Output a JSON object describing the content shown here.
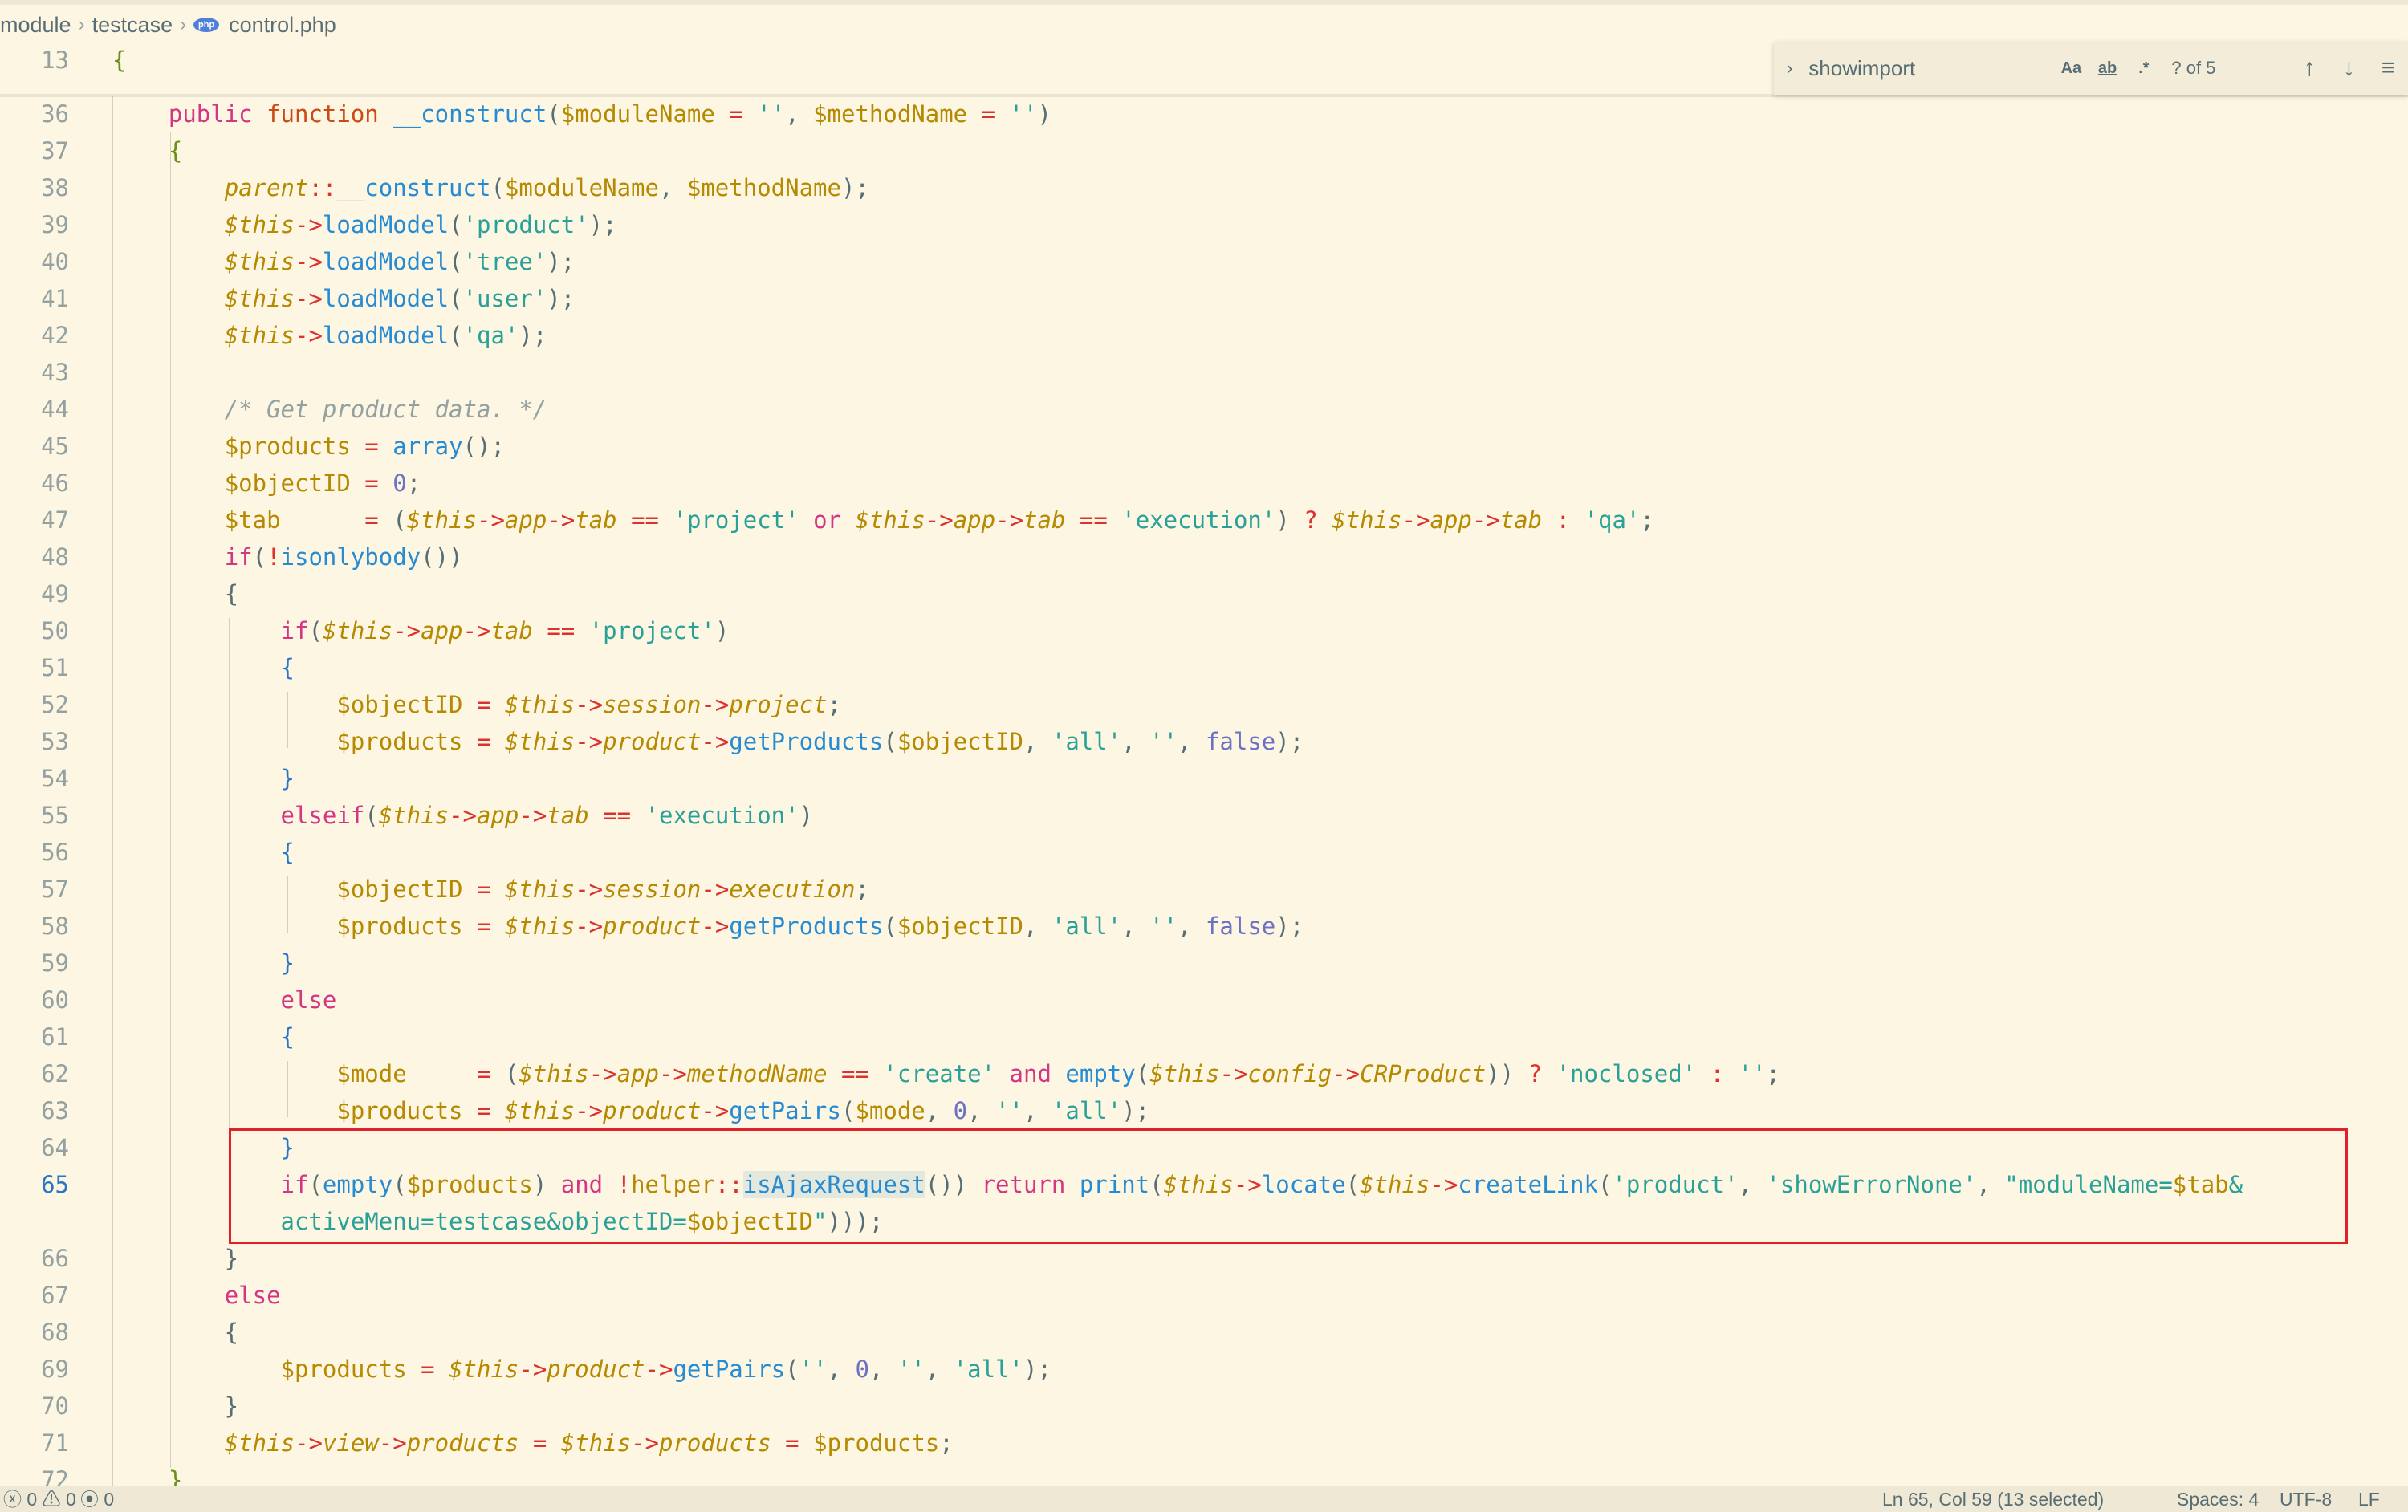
{
  "breadcrumb": {
    "items": [
      "module",
      "testcase",
      "control.php"
    ],
    "file_icon_text": "php"
  },
  "find_widget": {
    "query": "showimport",
    "match_case_label": "Aa",
    "whole_word_label": "ab",
    "regex_label": ".*",
    "match_count": "? of 5"
  },
  "editor": {
    "lines": [
      {
        "n": "13",
        "html": "<span class=\"brace\">{</span>"
      },
      {
        "n": "36",
        "html": "    <span class=\"k-pink\">public</span> <span class=\"k-orange\">function</span> <span class=\"fn\">__construct</span>(<span class=\"var\">$moduleName</span> <span class=\"op\">=</span> <span class=\"str\">''</span>, <span class=\"var\">$methodName</span> <span class=\"op\">=</span> <span class=\"str\">''</span>)"
      },
      {
        "n": "37",
        "html": "    <span class=\"brace\">{</span>"
      },
      {
        "n": "38",
        "html": "        <span class=\"var ital\">parent</span><span class=\"op\">::</span><span class=\"fn\">__construct</span>(<span class=\"var\">$moduleName</span>, <span class=\"var\">$methodName</span>);"
      },
      {
        "n": "39",
        "html": "        <span class=\"var ital\">$this</span><span class=\"op\">-&gt;</span><span class=\"fn\">loadModel</span>(<span class=\"str\">'product'</span>);"
      },
      {
        "n": "40",
        "html": "        <span class=\"var ital\">$this</span><span class=\"op\">-&gt;</span><span class=\"fn\">loadModel</span>(<span class=\"str\">'tree'</span>);"
      },
      {
        "n": "41",
        "html": "        <span class=\"var ital\">$this</span><span class=\"op\">-&gt;</span><span class=\"fn\">loadModel</span>(<span class=\"str\">'user'</span>);"
      },
      {
        "n": "42",
        "html": "        <span class=\"var ital\">$this</span><span class=\"op\">-&gt;</span><span class=\"fn\">loadModel</span>(<span class=\"str\">'qa'</span>);"
      },
      {
        "n": "43",
        "html": ""
      },
      {
        "n": "44",
        "html": "        <span class=\"cm\">/* Get product data. */</span>"
      },
      {
        "n": "45",
        "html": "        <span class=\"var\">$products</span> <span class=\"op\">=</span> <span class=\"fn\">array</span>();"
      },
      {
        "n": "46",
        "html": "        <span class=\"var\">$objectID</span> <span class=\"op\">=</span> <span class=\"num\">0</span>;"
      },
      {
        "n": "47",
        "html": "        <span class=\"var\">$tab</span>      <span class=\"op\">=</span> (<span class=\"var ital\">$this</span><span class=\"op\">-&gt;</span><span class=\"var ital\">app</span><span class=\"op\">-&gt;</span><span class=\"var ital\">tab</span> <span class=\"op\">==</span> <span class=\"str\">'project'</span> <span class=\"k-pink\">or</span> <span class=\"var ital\">$this</span><span class=\"op\">-&gt;</span><span class=\"var ital\">app</span><span class=\"op\">-&gt;</span><span class=\"var ital\">tab</span> <span class=\"op\">==</span> <span class=\"str\">'execution'</span>) <span class=\"op\">?</span> <span class=\"var ital\">$this</span><span class=\"op\">-&gt;</span><span class=\"var ital\">app</span><span class=\"op\">-&gt;</span><span class=\"var ital\">tab</span> <span class=\"op\">:</span> <span class=\"str\">'qa'</span>;"
      },
      {
        "n": "48",
        "html": "        <span class=\"k-pink\">if</span>(<span class=\"op\">!</span><span class=\"fn\">isonlybody</span>())"
      },
      {
        "n": "49",
        "html": "        {"
      },
      {
        "n": "50",
        "html": "            <span class=\"k-pink\">if</span>(<span class=\"var ital\">$this</span><span class=\"op\">-&gt;</span><span class=\"var ital\">app</span><span class=\"op\">-&gt;</span><span class=\"var ital\">tab</span> <span class=\"op\">==</span> <span class=\"str\">'project'</span>)"
      },
      {
        "n": "51",
        "html": "            <span class=\"brace2\">{</span>"
      },
      {
        "n": "52",
        "html": "                <span class=\"var\">$objectID</span> <span class=\"op\">=</span> <span class=\"var ital\">$this</span><span class=\"op\">-&gt;</span><span class=\"var ital\">session</span><span class=\"op\">-&gt;</span><span class=\"var ital\">project</span>;"
      },
      {
        "n": "53",
        "html": "                <span class=\"var\">$products</span> <span class=\"op\">=</span> <span class=\"var ital\">$this</span><span class=\"op\">-&gt;</span><span class=\"var ital\">product</span><span class=\"op\">-&gt;</span><span class=\"fn\">getProducts</span>(<span class=\"var\">$objectID</span>, <span class=\"str\">'all'</span>, <span class=\"str\">''</span>, <span class=\"num\">false</span>);"
      },
      {
        "n": "54",
        "html": "            <span class=\"brace2\">}</span>"
      },
      {
        "n": "55",
        "html": "            <span class=\"k-pink\">elseif</span>(<span class=\"var ital\">$this</span><span class=\"op\">-&gt;</span><span class=\"var ital\">app</span><span class=\"op\">-&gt;</span><span class=\"var ital\">tab</span> <span class=\"op\">==</span> <span class=\"str\">'execution'</span>)"
      },
      {
        "n": "56",
        "html": "            <span class=\"brace2\">{</span>"
      },
      {
        "n": "57",
        "html": "                <span class=\"var\">$objectID</span> <span class=\"op\">=</span> <span class=\"var ital\">$this</span><span class=\"op\">-&gt;</span><span class=\"var ital\">session</span><span class=\"op\">-&gt;</span><span class=\"var ital\">execution</span>;"
      },
      {
        "n": "58",
        "html": "                <span class=\"var\">$products</span> <span class=\"op\">=</span> <span class=\"var ital\">$this</span><span class=\"op\">-&gt;</span><span class=\"var ital\">product</span><span class=\"op\">-&gt;</span><span class=\"fn\">getProducts</span>(<span class=\"var\">$objectID</span>, <span class=\"str\">'all'</span>, <span class=\"str\">''</span>, <span class=\"num\">false</span>);"
      },
      {
        "n": "59",
        "html": "            <span class=\"brace2\">}</span>"
      },
      {
        "n": "60",
        "html": "            <span class=\"k-pink\">else</span>"
      },
      {
        "n": "61",
        "html": "            <span class=\"brace2\">{</span>"
      },
      {
        "n": "62",
        "html": "                <span class=\"var\">$mode</span>     <span class=\"op\">=</span> (<span class=\"var ital\">$this</span><span class=\"op\">-&gt;</span><span class=\"var ital\">app</span><span class=\"op\">-&gt;</span><span class=\"var ital\">methodName</span> <span class=\"op\">==</span> <span class=\"str\">'create'</span> <span class=\"k-pink\">and</span> <span class=\"fn\">empty</span>(<span class=\"var ital\">$this</span><span class=\"op\">-&gt;</span><span class=\"var ital\">config</span><span class=\"op\">-&gt;</span><span class=\"var ital\">CRProduct</span>)) <span class=\"op\">?</span> <span class=\"str\">'noclosed'</span> <span class=\"op\">:</span> <span class=\"str\">''</span>;"
      },
      {
        "n": "63",
        "html": "                <span class=\"var\">$products</span> <span class=\"op\">=</span> <span class=\"var ital\">$this</span><span class=\"op\">-&gt;</span><span class=\"var ital\">product</span><span class=\"op\">-&gt;</span><span class=\"fn\">getPairs</span>(<span class=\"var\">$mode</span>, <span class=\"num\">0</span>, <span class=\"str\">''</span>, <span class=\"str\">'all'</span>);"
      },
      {
        "n": "64",
        "html": "            <span class=\"brace2\">}</span>"
      },
      {
        "n": "65",
        "html": "            <span class=\"k-pink\">if</span>(<span class=\"fn\">empty</span>(<span class=\"var\">$products</span>) <span class=\"k-pink\">and</span> <span class=\"op\">!</span><span class=\"var\">helper</span><span class=\"op\">::</span><span class=\"fn hl\">isAjaxRequest</span>()) <span class=\"k-pink\">return</span> <span class=\"fn\">print</span>(<span class=\"var ital\">$this</span><span class=\"op\">-&gt;</span><span class=\"fn\">locate</span>(<span class=\"var ital\">$this</span><span class=\"op\">-&gt;</span><span class=\"fn\">createLink</span>(<span class=\"str\">'product'</span>, <span class=\"str\">'showErrorNone'</span>, <span class=\"str\">\"moduleName=</span><span class=\"var\">$tab</span><span class=\"str\">&amp;</span>"
      },
      {
        "n": "",
        "html": "            <span class=\"str\">activeMenu=testcase&amp;objectID=</span><span class=\"var\">$objectID</span><span class=\"str\">\"</span>)));"
      },
      {
        "n": "66",
        "html": "        }"
      },
      {
        "n": "67",
        "html": "        <span class=\"k-pink\">else</span>"
      },
      {
        "n": "68",
        "html": "        {"
      },
      {
        "n": "69",
        "html": "            <span class=\"var\">$products</span> <span class=\"op\">=</span> <span class=\"var ital\">$this</span><span class=\"op\">-&gt;</span><span class=\"var ital\">product</span><span class=\"op\">-&gt;</span><span class=\"fn\">getPairs</span>(<span class=\"str\">''</span>, <span class=\"num\">0</span>, <span class=\"str\">''</span>, <span class=\"str\">'all'</span>);"
      },
      {
        "n": "70",
        "html": "        }"
      },
      {
        "n": "71",
        "html": "        <span class=\"var ital\">$this</span><span class=\"op\">-&gt;</span><span class=\"var ital\">view</span><span class=\"op\">-&gt;</span><span class=\"var ital\">products</span> <span class=\"op\">=</span> <span class=\"var ital\">$this</span><span class=\"op\">-&gt;</span><span class=\"var ital\">products</span> <span class=\"op\">=</span> <span class=\"var\">$products</span>;"
      },
      {
        "n": "72",
        "html": "    <span class=\"brace\">}</span>"
      }
    ],
    "active_line": "65"
  },
  "status_bar": {
    "errors": "0",
    "warnings": "0",
    "ports": "0",
    "position": "Ln 65, Col 59 (13 selected)",
    "spaces": "Spaces: 4",
    "encoding": "UTF-8",
    "eol": "LF"
  }
}
